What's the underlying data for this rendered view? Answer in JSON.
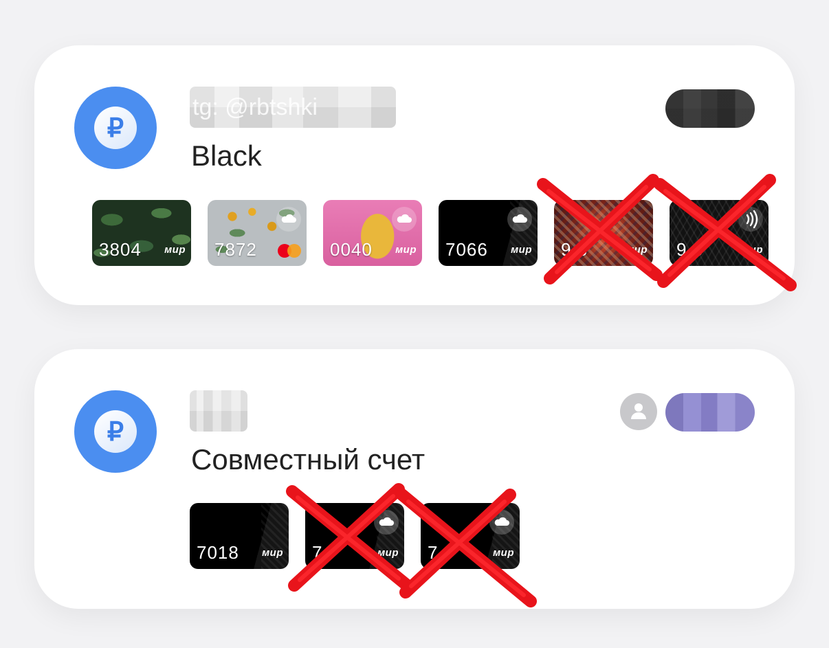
{
  "accounts": [
    {
      "watermark": "tg: @rbtshki",
      "name": "Black",
      "currency_symbol": "₽",
      "cards": [
        {
          "number": "3804",
          "network": "мир",
          "art": "jungle"
        },
        {
          "number": "7872",
          "network": "mastercard",
          "art": "lemons"
        },
        {
          "number": "0040",
          "network": "мир",
          "art": "leopard"
        },
        {
          "number": "7066",
          "network": "мир",
          "art": "black"
        },
        {
          "number": "9  8",
          "network": "мир",
          "art": "carpet",
          "crossed_out": true
        },
        {
          "number": "9  3",
          "network": "мир",
          "art": "dark-pattern",
          "crossed_out": true
        }
      ]
    },
    {
      "name": "Совместный счет",
      "currency_symbol": "₽",
      "cards": [
        {
          "number": "7018",
          "network": "мир",
          "art": "black"
        },
        {
          "number": "7",
          "network": "мир",
          "art": "black",
          "crossed_out": true
        },
        {
          "number": "7",
          "network": "мир",
          "art": "black",
          "crossed_out": true
        }
      ]
    }
  ],
  "colors": {
    "accent_blue": "#4b8ef0",
    "cross_red": "#e8141b",
    "card_bg": "#ffffff",
    "page_bg": "#f2f2f4"
  },
  "icons": {
    "currency": "ruble-icon",
    "cloud": "cloud-icon",
    "nfc": "nfc-icon",
    "shared_user": "user-icon"
  }
}
